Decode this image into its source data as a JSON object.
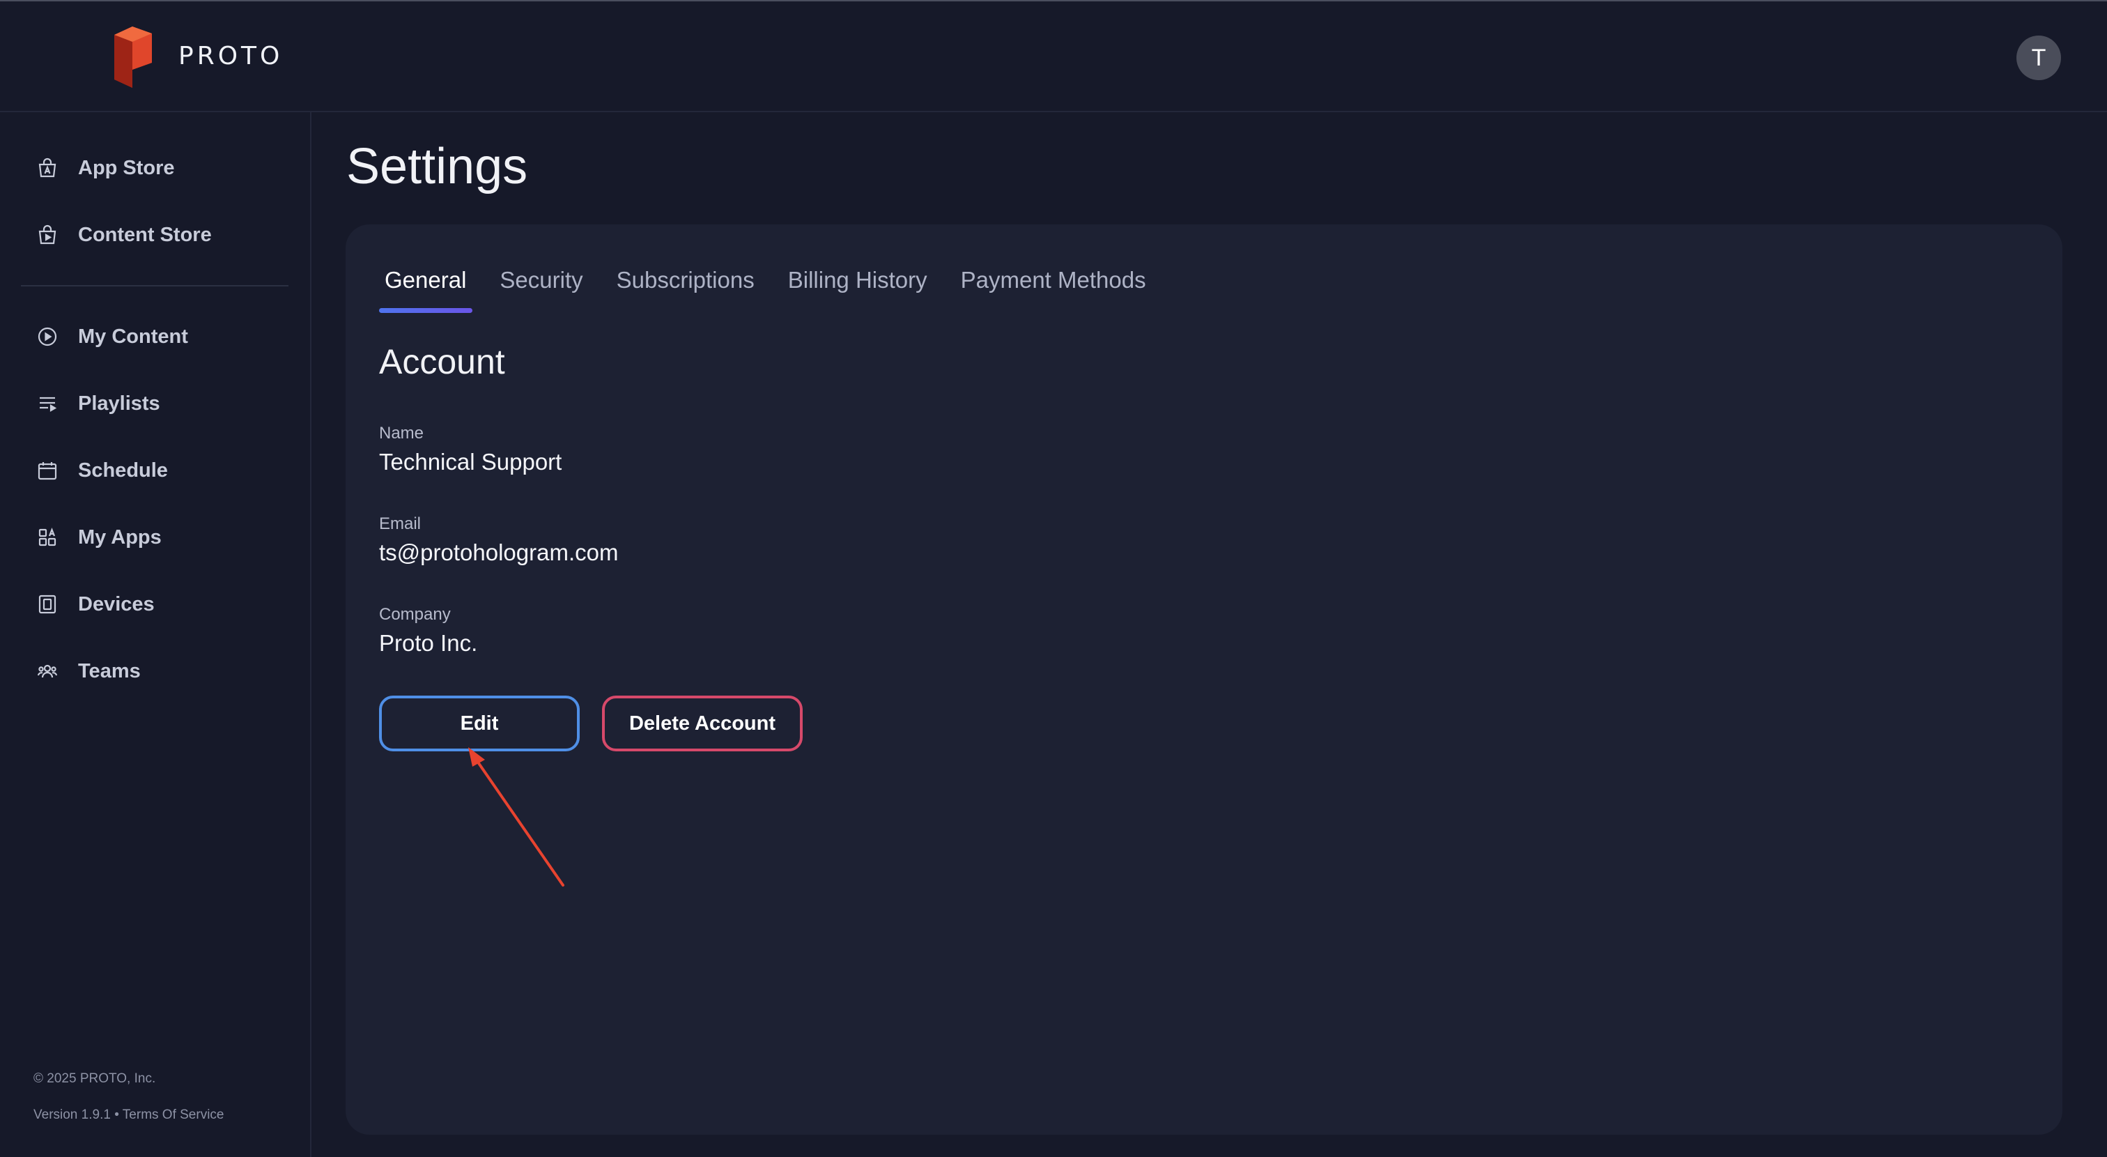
{
  "header": {
    "logo_text": "PROTO",
    "avatar_initial": "T"
  },
  "sidebar": {
    "items": [
      {
        "label": "App Store",
        "icon": "shopping-bag-a-icon"
      },
      {
        "label": "Content Store",
        "icon": "shopping-bag-play-icon"
      },
      {
        "label": "My Content",
        "icon": "play-circle-icon"
      },
      {
        "label": "Playlists",
        "icon": "playlist-icon"
      },
      {
        "label": "Schedule",
        "icon": "calendar-icon"
      },
      {
        "label": "My Apps",
        "icon": "apps-grid-icon"
      },
      {
        "label": "Devices",
        "icon": "device-icon"
      },
      {
        "label": "Teams",
        "icon": "team-icon"
      }
    ],
    "copyright": "© 2025 PROTO, Inc.",
    "version": "Version 1.9.1",
    "separator": "•",
    "terms_link": "Terms Of Service"
  },
  "page": {
    "title": "Settings",
    "tabs": [
      {
        "label": "General",
        "active": true
      },
      {
        "label": "Security",
        "active": false
      },
      {
        "label": "Subscriptions",
        "active": false
      },
      {
        "label": "Billing History",
        "active": false
      },
      {
        "label": "Payment Methods",
        "active": false
      }
    ],
    "section_title": "Account",
    "fields": {
      "name_label": "Name",
      "name_value": "Technical Support",
      "email_label": "Email",
      "email_value": "ts@protohologram.com",
      "company_label": "Company",
      "company_value": "Proto Inc."
    },
    "buttons": {
      "edit": "Edit",
      "delete": "Delete Account"
    }
  },
  "colors": {
    "background": "#161929",
    "panel": "#1d2133",
    "accent_tab": "#5a66ec",
    "edit_border": "#4f8fe6",
    "delete_border": "#d6496a",
    "annotation_arrow": "#e8432f"
  }
}
